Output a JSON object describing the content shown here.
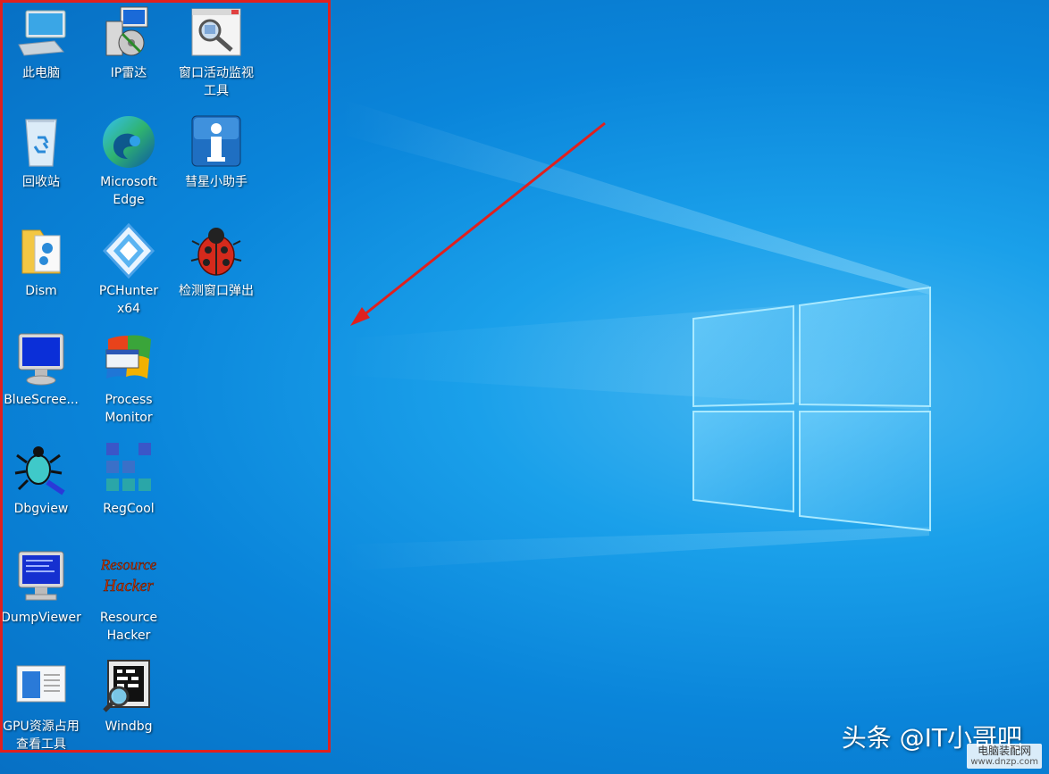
{
  "desktop": {
    "icons": [
      {
        "label": "此电脑",
        "icon": "computer-icon"
      },
      {
        "label": "IP雷达",
        "icon": "ip-radar-icon"
      },
      {
        "label": "窗口活动监视\n工具",
        "icon": "window-monitor-icon"
      },
      {
        "label": "回收站",
        "icon": "recycle-bin-icon"
      },
      {
        "label": "Microsoft\nEdge",
        "icon": "edge-icon"
      },
      {
        "label": "彗星小助手",
        "icon": "comet-helper-icon"
      },
      {
        "label": "Dism",
        "icon": "dism-folder-icon"
      },
      {
        "label": "PCHunter\nx64",
        "icon": "pchunter-icon"
      },
      {
        "label": "检测窗口弹出",
        "icon": "ladybug-icon"
      },
      {
        "label": "BlueScree...",
        "icon": "bluescreen-monitor-icon"
      },
      {
        "label": "Process\nMonitor",
        "icon": "process-monitor-icon"
      },
      {
        "label": "Dbgview",
        "icon": "dbgview-bug-icon"
      },
      {
        "label": "RegCool",
        "icon": "regcool-icon"
      },
      {
        "label": "DumpViewer",
        "icon": "dumpviewer-monitor-icon"
      },
      {
        "label": "Resource\nHacker",
        "icon": "resource-hacker-icon"
      },
      {
        "label": "GPU资源占用\n查看工具",
        "icon": "gpu-tool-icon"
      },
      {
        "label": "Windbg",
        "icon": "windbg-icon"
      }
    ],
    "resource_hacker_logo_text": [
      "Resource",
      "Hacker"
    ]
  },
  "annotation": {
    "box_color": "#e0201e",
    "arrow_color": "#e0201e"
  },
  "watermark": {
    "text": "头条 @IT小哥吧",
    "site_name": "电脑装配网",
    "site_url": "www.dnzp.com"
  },
  "colors": {
    "wallpaper_blue": "#0a85da",
    "logo_light": "#7fd8ff"
  }
}
